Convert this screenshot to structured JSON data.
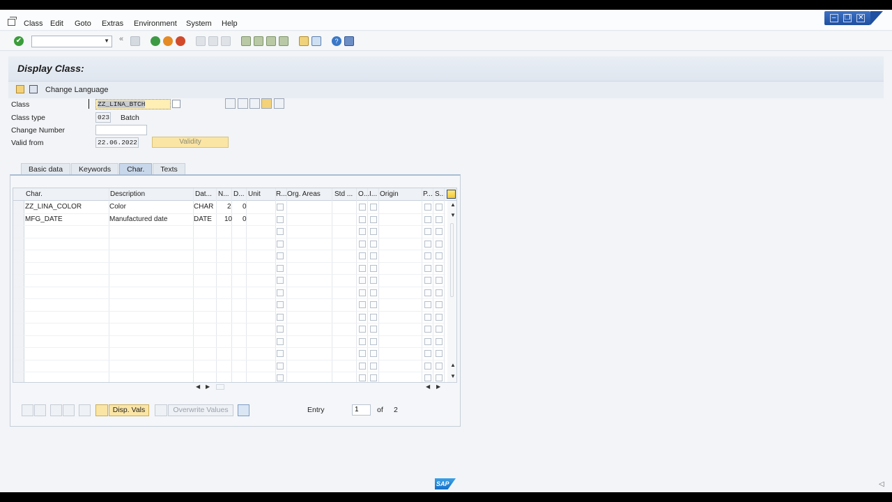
{
  "menubar": {
    "items": [
      "Class",
      "Edit",
      "Goto",
      "Extras",
      "Environment",
      "System",
      "Help"
    ]
  },
  "window": {
    "minimize": "–",
    "restore": "❐",
    "close": "✕"
  },
  "toolbar": {
    "command_field": "",
    "enter_glyph": "✔"
  },
  "page": {
    "title": "Display Class:"
  },
  "apptoolbar": {
    "change_language": "Change Language"
  },
  "form": {
    "class_label": "Class",
    "class_value": "ZZ_LINA_BTCH",
    "class_type_label": "Class type",
    "class_type_value": "023",
    "class_type_desc": "Batch",
    "change_number_label": "Change Number",
    "change_number_value": "",
    "valid_from_label": "Valid from",
    "valid_from_value": "22.06.2022",
    "validity_button": "Validity"
  },
  "tabs": [
    {
      "label": "Basic data",
      "active": false
    },
    {
      "label": "Keywords",
      "active": false
    },
    {
      "label": "Char.",
      "active": true
    },
    {
      "label": "Texts",
      "active": false
    }
  ],
  "grid": {
    "headers": {
      "char": "Char.",
      "description": "Description",
      "data_type": "Dat...",
      "num_chars": "N...",
      "decimals": "D...",
      "unit": "Unit",
      "required": "R...",
      "org_areas": "Org. Areas",
      "std": "Std ...",
      "o": "O...",
      "i": "I...",
      "origin": "Origin",
      "p": "P...",
      "s": "S..."
    },
    "rows": [
      {
        "char": "ZZ_LINA_COLOR",
        "description": "Color",
        "data_type": "CHAR",
        "num_chars": "2",
        "decimals": "0"
      },
      {
        "char": "MFG_DATE",
        "description": "Manufactured date",
        "data_type": "DATE",
        "num_chars": "10",
        "decimals": "0"
      }
    ]
  },
  "footer": {
    "disp_vals": "Disp. Vals",
    "overwrite_values": "Overwrite Values",
    "entry_label": "Entry",
    "entry_value": "1",
    "of_label": "of",
    "total": "2"
  },
  "brand": {
    "logo_text": "SAP"
  }
}
